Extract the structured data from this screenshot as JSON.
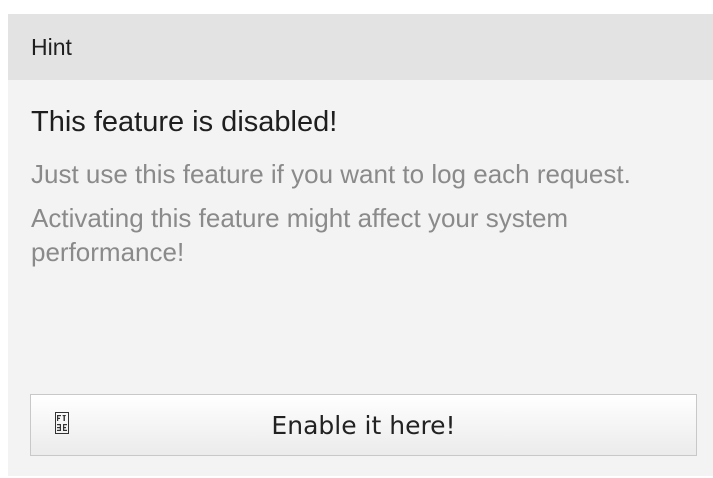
{
  "widget": {
    "header": "Hint",
    "title": "This feature is disabled!",
    "description_1": "Just use this feature if you want to log each request.",
    "description_2": "Activating this feature might affect your system performance!",
    "button_label": "Enable it here!",
    "button_icon": "missing-glyph-icon"
  }
}
